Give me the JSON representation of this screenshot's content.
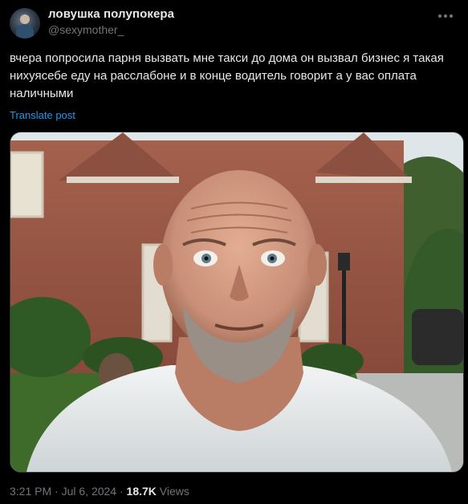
{
  "author": {
    "display_name": "ловушка полупокера",
    "handle": "@sexymother_"
  },
  "tweet": {
    "text": "вчера попросила парня вызвать мне такси до дома он вызвал бизнес я такая нихуясебе еду на расслабоне и в конце водитель говорит а у вас оплата наличными",
    "translate_label": "Translate post"
  },
  "media": {
    "icon": "photo",
    "colors": {
      "brick": "#9c5a48",
      "sky": "#dfe6ea",
      "shirt": "#e9ecec",
      "skin": "#c98f78",
      "lawn": "#3f6b2a"
    }
  },
  "meta": {
    "time": "3:21 PM",
    "separator1": " · ",
    "date": "Jul 6, 2024",
    "separator2": " · ",
    "views_count": "18.7K",
    "views_label": " Views"
  },
  "icons": {
    "more": "more-horizontal-icon"
  }
}
